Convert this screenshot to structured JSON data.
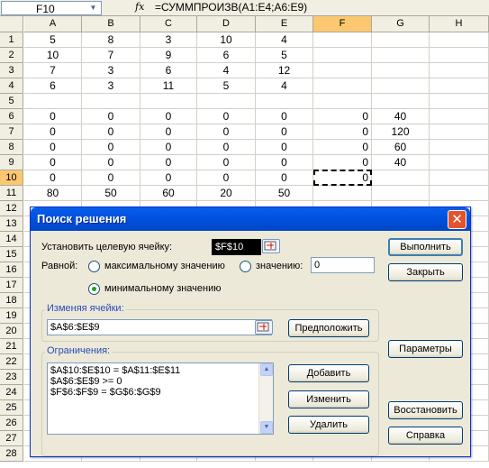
{
  "formula_bar": {
    "name_box": "F10",
    "fx": "fx",
    "formula": "=СУММПРОИЗВ(A1:E4;A6:E9)"
  },
  "sheet": {
    "columns": [
      "A",
      "B",
      "C",
      "D",
      "E",
      "F",
      "G",
      "H"
    ],
    "active_column": "F",
    "active_row": "10",
    "rows": [
      {
        "num": "1",
        "cells": [
          "5",
          "8",
          "3",
          "10",
          "4",
          "",
          "",
          ""
        ]
      },
      {
        "num": "2",
        "cells": [
          "10",
          "7",
          "9",
          "6",
          "5",
          "",
          "",
          ""
        ]
      },
      {
        "num": "3",
        "cells": [
          "7",
          "3",
          "6",
          "4",
          "12",
          "",
          "",
          ""
        ]
      },
      {
        "num": "4",
        "cells": [
          "6",
          "3",
          "11",
          "5",
          "4",
          "",
          "",
          ""
        ]
      },
      {
        "num": "5",
        "cells": [
          "",
          "",
          "",
          "",
          "",
          "",
          "",
          ""
        ]
      },
      {
        "num": "6",
        "cells": [
          "0",
          "0",
          "0",
          "0",
          "0",
          "0",
          "40",
          ""
        ]
      },
      {
        "num": "7",
        "cells": [
          "0",
          "0",
          "0",
          "0",
          "0",
          "0",
          "120",
          ""
        ]
      },
      {
        "num": "8",
        "cells": [
          "0",
          "0",
          "0",
          "0",
          "0",
          "0",
          "60",
          ""
        ]
      },
      {
        "num": "9",
        "cells": [
          "0",
          "0",
          "0",
          "0",
          "0",
          "0",
          "40",
          ""
        ]
      },
      {
        "num": "10",
        "cells": [
          "0",
          "0",
          "0",
          "0",
          "0",
          "0",
          "",
          ""
        ]
      },
      {
        "num": "11",
        "cells": [
          "80",
          "50",
          "60",
          "20",
          "50",
          "",
          "",
          ""
        ]
      },
      {
        "num": "12",
        "cells": []
      },
      {
        "num": "13",
        "cells": []
      },
      {
        "num": "14",
        "cells": []
      },
      {
        "num": "15",
        "cells": []
      },
      {
        "num": "16",
        "cells": []
      },
      {
        "num": "17",
        "cells": []
      },
      {
        "num": "18",
        "cells": []
      },
      {
        "num": "19",
        "cells": []
      },
      {
        "num": "20",
        "cells": []
      },
      {
        "num": "21",
        "cells": []
      },
      {
        "num": "22",
        "cells": []
      },
      {
        "num": "23",
        "cells": []
      },
      {
        "num": "24",
        "cells": []
      },
      {
        "num": "25",
        "cells": []
      },
      {
        "num": "26",
        "cells": []
      },
      {
        "num": "27",
        "cells": []
      },
      {
        "num": "28",
        "cells": []
      }
    ]
  },
  "dialog": {
    "title": "Поиск решения",
    "close": "✕",
    "target_label": "Установить целевую ячейку:",
    "target_value": "$F$10",
    "equal_label": "Равной:",
    "radio_max": "максимальному значению",
    "radio_value": "значению:",
    "value_input": "0",
    "radio_min": "минимальному значению",
    "selected_option": "min",
    "changing_label": "Изменяя ячейки:",
    "changing_value": "$A$6:$E$9",
    "guess_button": "Предположить",
    "constraints_label": "Ограничения:",
    "constraints": [
      "$A$10:$E$10 = $A$11:$E$11",
      "$A$6:$E$9 >= 0",
      "$F$6:$F$9 = $G$6:$G$9"
    ],
    "add_button": "Добавить",
    "change_button": "Изменить",
    "delete_button": "Удалить",
    "solve_button": "Выполнить",
    "close_button": "Закрыть",
    "options_button": "Параметры",
    "reset_button": "Восстановить",
    "help_button": "Справка",
    "scroll_up": "▲",
    "scroll_down": "▼"
  },
  "colors": {
    "title_bar": "#0053e0",
    "dialog_bg": "#ece9d8",
    "group_label": "#2a4bb8",
    "active_header": "#fbc870"
  }
}
